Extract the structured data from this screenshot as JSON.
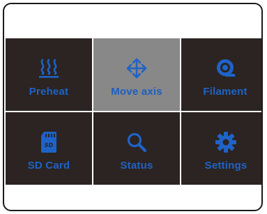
{
  "menu": {
    "items": [
      {
        "label": "Preheat",
        "icon": "heat-waves-icon"
      },
      {
        "label": "Move axis",
        "icon": "move-arrows-icon",
        "selected": true
      },
      {
        "label": "Filament",
        "icon": "filament-spool-icon"
      },
      {
        "label": "SD Card",
        "icon": "sd-card-icon"
      },
      {
        "label": "Status",
        "icon": "magnifier-icon"
      },
      {
        "label": "Settings",
        "icon": "gear-icon"
      }
    ]
  },
  "colors": {
    "tile_bg": "#2b2422",
    "tile_selected_bg": "#888888",
    "accent": "#1e63c7",
    "border": "#1a1a1a"
  }
}
